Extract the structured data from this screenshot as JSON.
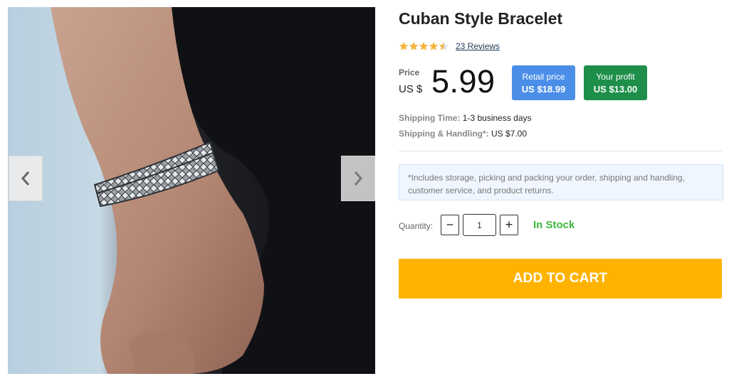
{
  "gallery": {
    "prev_icon": "chevron-left-icon",
    "next_icon": "chevron-right-icon"
  },
  "product": {
    "title": "Cuban Style Bracelet",
    "rating_value": 4.5,
    "rating_max": 5,
    "reviews_link": "23 Reviews"
  },
  "price": {
    "label": "Price",
    "currency": "US $",
    "value": "5.99"
  },
  "badges": {
    "retail_label": "Retail price",
    "retail_value": "US $18.99",
    "profit_label": "Your profit",
    "profit_value": "US $13.00"
  },
  "shipping": {
    "time_label": "Shipping Time:",
    "time_value": "1-3 business days",
    "handling_label": "Shipping & Handling*:",
    "handling_value": "US $7.00"
  },
  "note": "*Includes storage, picking and packing your order, shipping and handling, customer service, and product returns.",
  "quantity": {
    "label": "Quantity:",
    "minus": "−",
    "plus": "+",
    "value": "1"
  },
  "stock_status": "In Stock",
  "cart_button": "ADD TO CART",
  "colors": {
    "star": "#f5b53f",
    "retail_badge": "#4a8ee8",
    "profit_badge": "#1e8f4a",
    "in_stock": "#3cb83c",
    "cart_button": "#ffb300"
  }
}
